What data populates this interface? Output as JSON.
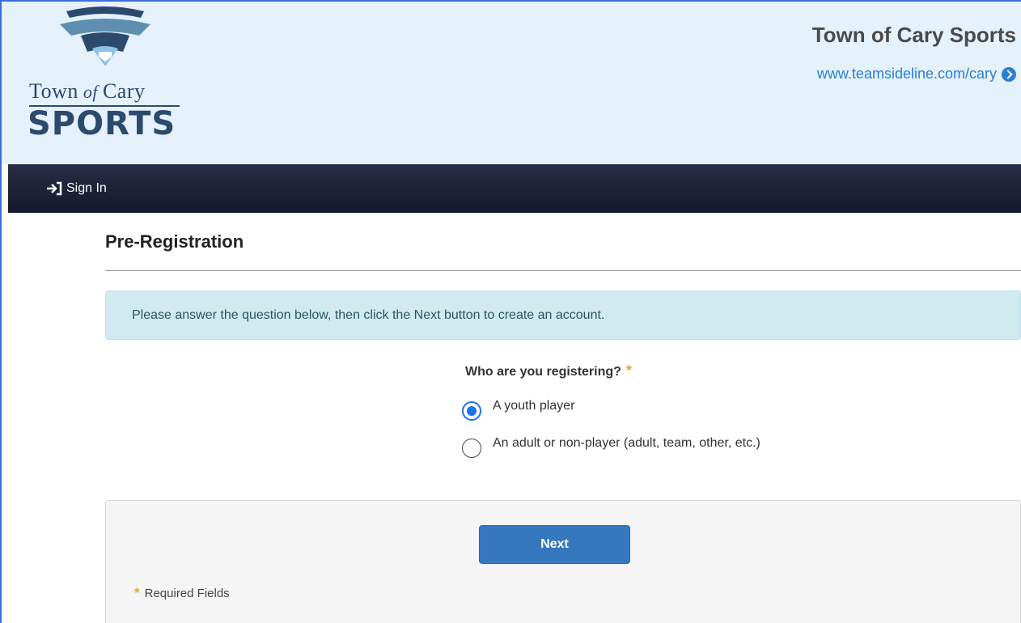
{
  "header": {
    "logo_town": "Town",
    "logo_of": "of",
    "logo_cary": "Cary",
    "logo_sports": "SPORTS",
    "site_title": "Town of Cary Sports",
    "site_link": "www.teamsideline.com/cary",
    "bg_color": "#e5f1fb",
    "logo_color": "#2c4a6e",
    "link_color": "#2a7fd4"
  },
  "nav": {
    "signin_label": "Sign In",
    "signin_icon": "sign-in-icon"
  },
  "page": {
    "title": "Pre-Registration",
    "info_text": "Please answer the question below, then click the Next button to create an account."
  },
  "form": {
    "question": "Who are you registering?",
    "required_mark": "*",
    "options": [
      {
        "label": "A youth player",
        "checked": true
      },
      {
        "label": "An adult or non-player (adult, team, other, etc.)",
        "checked": false
      }
    ],
    "next_label": "Next",
    "required_note": "Required Fields",
    "accent_color": "#1a73e8",
    "button_color": "#3578bf",
    "asterisk_color": "#f0a030"
  }
}
